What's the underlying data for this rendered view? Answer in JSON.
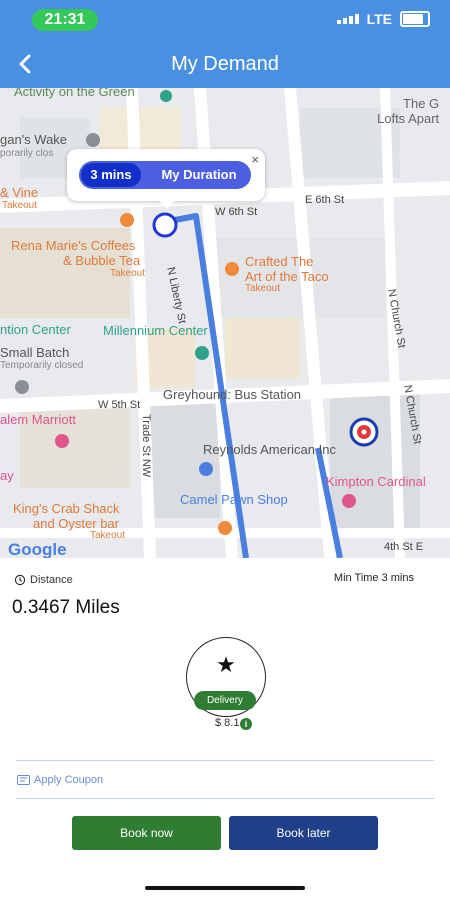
{
  "status_bar": {
    "time": "21:31",
    "network": "LTE"
  },
  "header": {
    "title": "My Demand",
    "back_icon": "chevron-left-icon"
  },
  "map": {
    "popup": {
      "eta": "3 mins",
      "label": "My Duration",
      "close": "×"
    },
    "labels": {
      "activity": "Activity on the Green",
      "lofts": "The G\nLofts Apart",
      "wake": "gan's Wake",
      "wake_sub": "porarily clos",
      "vine": "& Vine",
      "vine_sub": "Takeout",
      "w6th": "W 6th St",
      "e6th": "E 6th St",
      "rena": "Rena Marie's Coffees",
      "bubble_tea": "& Bubble Tea",
      "rena_sub": "Takeout",
      "crafted": "Crafted The",
      "art_taco": "Art of the Taco",
      "crafted_sub": "Takeout",
      "n_liberty": "N Liberty St",
      "n_church1": "N Church St",
      "n_church2": "N Church St",
      "center": "ntion Center",
      "millennium": "Millennium Center",
      "small_batch": "Small Batch",
      "small_sub": "Temporarily closed",
      "greyhound": "Greyhound: Bus Station",
      "w5th": "W 5th St",
      "marriott": "alem Marriott",
      "trade": "Trade St NW",
      "reynolds": "Reynolds American Inc",
      "kimpton": "Kimpton Cardinal",
      "camel": "Camel Pawn Shop",
      "crab": "King's Crab Shack",
      "oyster": "and Oyster bar",
      "crab_sub": "Takeout",
      "fourth": "4th St E",
      "google": "Google",
      "ay": "ay"
    }
  },
  "trip": {
    "distance_label": "Distance",
    "distance_value": "0.3467 Miles",
    "min_time": "Min Time 3 mins"
  },
  "vehicle": {
    "icon": "star-icon",
    "type": "Delivery",
    "price": "$ 8.1",
    "info": "i"
  },
  "coupon": {
    "label": "Apply Coupon"
  },
  "actions": {
    "book_now": "Book now",
    "book_later": "Book later"
  },
  "colors": {
    "header": "#4a90e2",
    "route": "#4a7fe0",
    "book_now": "#2e7d32",
    "book_later": "#1f3f88"
  }
}
